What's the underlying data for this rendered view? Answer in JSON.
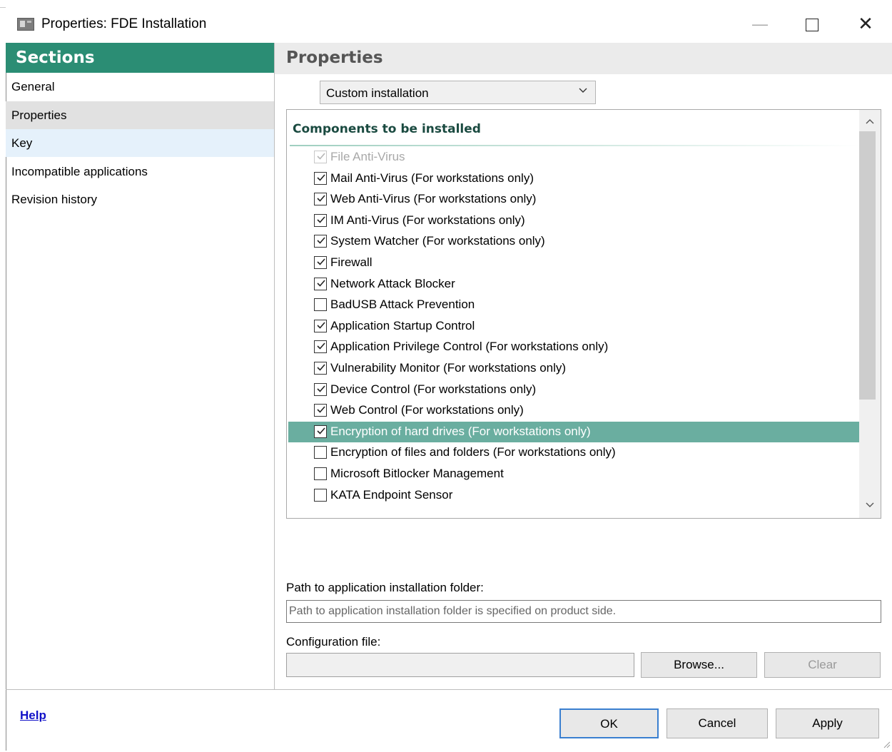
{
  "window": {
    "title": "Properties: FDE Installation"
  },
  "sections": {
    "heading": "Sections",
    "items": [
      {
        "label": "General",
        "state": "normal"
      },
      {
        "label": "Properties",
        "state": "selected"
      },
      {
        "label": "Key",
        "state": "hover"
      },
      {
        "label": "Incompatible applications",
        "state": "normal"
      },
      {
        "label": "Revision history",
        "state": "normal"
      }
    ]
  },
  "properties": {
    "heading": "Properties",
    "install_type": "Custom installation",
    "components_heading": "Components to be installed",
    "components": [
      {
        "label": "File Anti-Virus",
        "checked": true,
        "disabled": true,
        "selected": false
      },
      {
        "label": "Mail Anti-Virus (For workstations only)",
        "checked": true,
        "disabled": false,
        "selected": false
      },
      {
        "label": "Web Anti-Virus (For workstations only)",
        "checked": true,
        "disabled": false,
        "selected": false
      },
      {
        "label": "IM Anti-Virus (For workstations only)",
        "checked": true,
        "disabled": false,
        "selected": false
      },
      {
        "label": "System Watcher (For workstations only)",
        "checked": true,
        "disabled": false,
        "selected": false
      },
      {
        "label": "Firewall",
        "checked": true,
        "disabled": false,
        "selected": false
      },
      {
        "label": "Network Attack Blocker",
        "checked": true,
        "disabled": false,
        "selected": false
      },
      {
        "label": "BadUSB Attack Prevention",
        "checked": false,
        "disabled": false,
        "selected": false
      },
      {
        "label": "Application Startup Control",
        "checked": true,
        "disabled": false,
        "selected": false
      },
      {
        "label": "Application Privilege Control (For workstations only)",
        "checked": true,
        "disabled": false,
        "selected": false
      },
      {
        "label": "Vulnerability Monitor (For workstations only)",
        "checked": true,
        "disabled": false,
        "selected": false
      },
      {
        "label": "Device Control (For workstations only)",
        "checked": true,
        "disabled": false,
        "selected": false
      },
      {
        "label": "Web Control (For workstations only)",
        "checked": true,
        "disabled": false,
        "selected": false
      },
      {
        "label": "Encryption of hard drives (For workstations only)",
        "checked": true,
        "disabled": false,
        "selected": true
      },
      {
        "label": "Encryption of files and folders (For workstations only)",
        "checked": false,
        "disabled": false,
        "selected": false
      },
      {
        "label": "Microsoft Bitlocker Management",
        "checked": false,
        "disabled": false,
        "selected": false
      },
      {
        "label": "KATA Endpoint Sensor",
        "checked": false,
        "disabled": false,
        "selected": false
      }
    ],
    "path_label": "Path to application installation folder:",
    "path_value": "Path to application installation folder is specified on product side.",
    "config_label": "Configuration file:",
    "config_value": "",
    "browse_label": "Browse...",
    "clear_label": "Clear"
  },
  "footer": {
    "help": "Help",
    "ok": "OK",
    "cancel": "Cancel",
    "apply": "Apply"
  },
  "colors": {
    "accent": "#2b8d74",
    "selected_row": "#6aaea0",
    "nav_selected": "#e1e1e1",
    "nav_hover": "#e5f1fb",
    "link": "#1010c8"
  }
}
